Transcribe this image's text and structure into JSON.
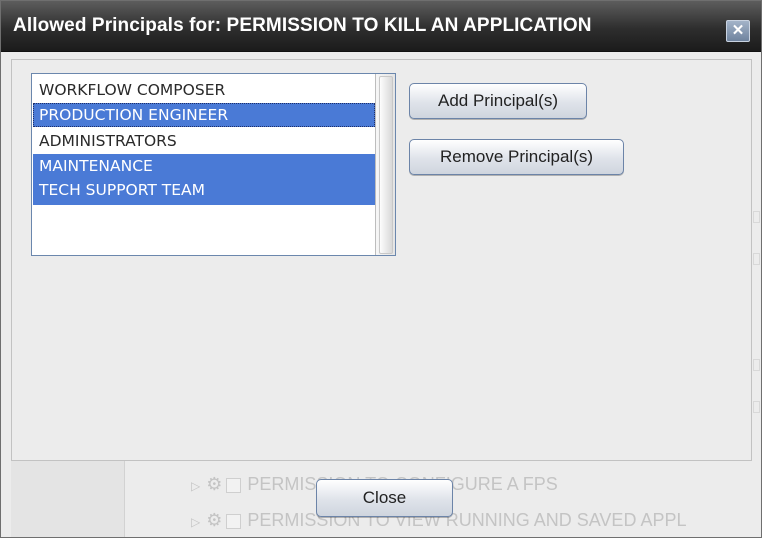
{
  "dialog": {
    "title": "Allowed Principals for: PERMISSION TO KILL AN APPLICATION",
    "close_icon": "close-icon"
  },
  "principals": {
    "items": [
      {
        "label": "WORKFLOW COMPOSER",
        "selected": false
      },
      {
        "label": "PRODUCTION ENGINEER",
        "selected": true,
        "focused": true
      },
      {
        "label": "ADMINISTRATORS",
        "selected": false
      },
      {
        "label": "MAINTENANCE",
        "selected": true
      },
      {
        "label": "TECH SUPPORT TEAM",
        "selected": true
      }
    ]
  },
  "actions": {
    "add_label": "Add Principal(s)",
    "remove_label": "Remove Principal(s)"
  },
  "footer": {
    "close_label": "Close"
  },
  "background_rows": [
    {
      "label": "PERMISSION TO CONFIGURE A FPS"
    },
    {
      "label": "PERMISSION TO VIEW RUNNING AND SAVED APPL"
    }
  ],
  "colors": {
    "selection": "#4a7ad6",
    "title_bar": "#2e2e2e",
    "button_border": "#6c84a8"
  }
}
